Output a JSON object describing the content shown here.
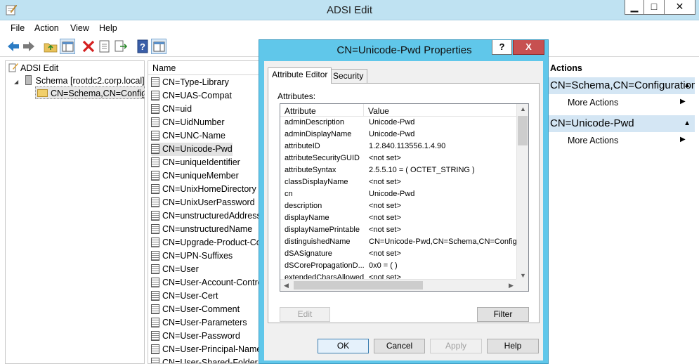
{
  "window": {
    "title": "ADSI Edit"
  },
  "menu": [
    "File",
    "Action",
    "View",
    "Help"
  ],
  "toolbar": {
    "icons": [
      "back-arrow-icon",
      "forward-arrow-icon",
      "up-folder-icon",
      "show-hide-tree-icon",
      "delete-icon",
      "properties-icon",
      "export-icon",
      "help-icon",
      "view-icon"
    ]
  },
  "tree": {
    "root": "ADSI Edit",
    "schema": "Schema [rootdc2.corp.local]",
    "selected": "CN=Schema,CN=Configuration"
  },
  "list": {
    "header": "Name",
    "items": [
      "CN=Type-Library",
      "CN=UAS-Compat",
      "CN=uid",
      "CN=UidNumber",
      "CN=UNC-Name",
      "CN=Unicode-Pwd",
      "CN=uniqueIdentifier",
      "CN=uniqueMember",
      "CN=UnixHomeDirectory",
      "CN=UnixUserPassword",
      "CN=unstructuredAddress",
      "CN=unstructuredName",
      "CN=Upgrade-Product-Code",
      "CN=UPN-Suffixes",
      "CN=User",
      "CN=User-Account-Control",
      "CN=User-Cert",
      "CN=User-Comment",
      "CN=User-Parameters",
      "CN=User-Password",
      "CN=User-Principal-Name",
      "CN=User-Shared-Folder"
    ],
    "selected_index": 5
  },
  "actions": {
    "title": "Actions",
    "section1": "CN=Schema,CN=Configuration",
    "section1_more": "More Actions",
    "section2": "CN=Unicode-Pwd",
    "section2_more": "More Actions"
  },
  "dialog": {
    "title": "CN=Unicode-Pwd Properties",
    "help_label": "?",
    "close_label": "X",
    "tabs": [
      "Attribute Editor",
      "Security"
    ],
    "attributes_label": "Attributes:",
    "columns": [
      "Attribute",
      "Value"
    ],
    "rows": [
      {
        "attr": "adminDescription",
        "value": "Unicode-Pwd"
      },
      {
        "attr": "adminDisplayName",
        "value": "Unicode-Pwd"
      },
      {
        "attr": "attributeID",
        "value": "1.2.840.113556.1.4.90"
      },
      {
        "attr": "attributeSecurityGUID",
        "value": "<not set>"
      },
      {
        "attr": "attributeSyntax",
        "value": "2.5.5.10 = ( OCTET_STRING )"
      },
      {
        "attr": "classDisplayName",
        "value": "<not set>"
      },
      {
        "attr": "cn",
        "value": "Unicode-Pwd"
      },
      {
        "attr": "description",
        "value": "<not set>"
      },
      {
        "attr": "displayName",
        "value": "<not set>"
      },
      {
        "attr": "displayNamePrintable",
        "value": "<not set>"
      },
      {
        "attr": "distinguishedName",
        "value": "CN=Unicode-Pwd,CN=Schema,CN=Configur"
      },
      {
        "attr": "dSASignature",
        "value": "<not set>"
      },
      {
        "attr": "dSCorePropagationD...",
        "value": "0x0 = ( )"
      },
      {
        "attr": "extendedCharsAllowed",
        "value": "<not set>"
      }
    ],
    "edit_label": "Edit",
    "filter_label": "Filter",
    "ok_label": "OK",
    "cancel_label": "Cancel",
    "apply_label": "Apply",
    "help_button_label": "Help"
  }
}
